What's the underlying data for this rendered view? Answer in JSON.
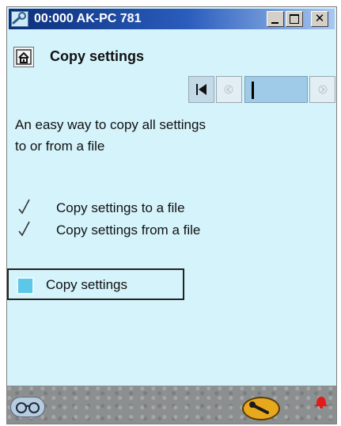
{
  "window": {
    "title": "00:000 AK-PC 781",
    "icon": "wrench-app-icon",
    "titlebar_color_left": "#0c2f79",
    "titlebar_color_right": "#a9c8f0",
    "buttons": {
      "minimize": "minimize-icon",
      "maximize": "maximize-icon",
      "close_label": "✕"
    }
  },
  "header": {
    "home_icon": "home-icon",
    "title": "Copy settings"
  },
  "navigation": {
    "first_icon": "first-page-icon",
    "prev_icon": "previous-page-icon",
    "next_icon": "next-page-icon",
    "field_value": ""
  },
  "content": {
    "description_line1": "An easy way to copy all settings",
    "description_line2": "to or from a file",
    "items": [
      {
        "label": "Copy settings to a file",
        "icon": "check-icon"
      },
      {
        "label": "Copy settings from a file",
        "icon": "check-icon"
      }
    ],
    "copy_option": {
      "label": "Copy settings",
      "indicator_color": "#5cc7e9"
    }
  },
  "bottom_bar": {
    "left_icon": "glasses-icon",
    "tool_icon": "wrench-icon",
    "alarm_icon": "bell-icon",
    "alarm_color": "#e11a1a",
    "background_color": "#d4f3fb"
  }
}
